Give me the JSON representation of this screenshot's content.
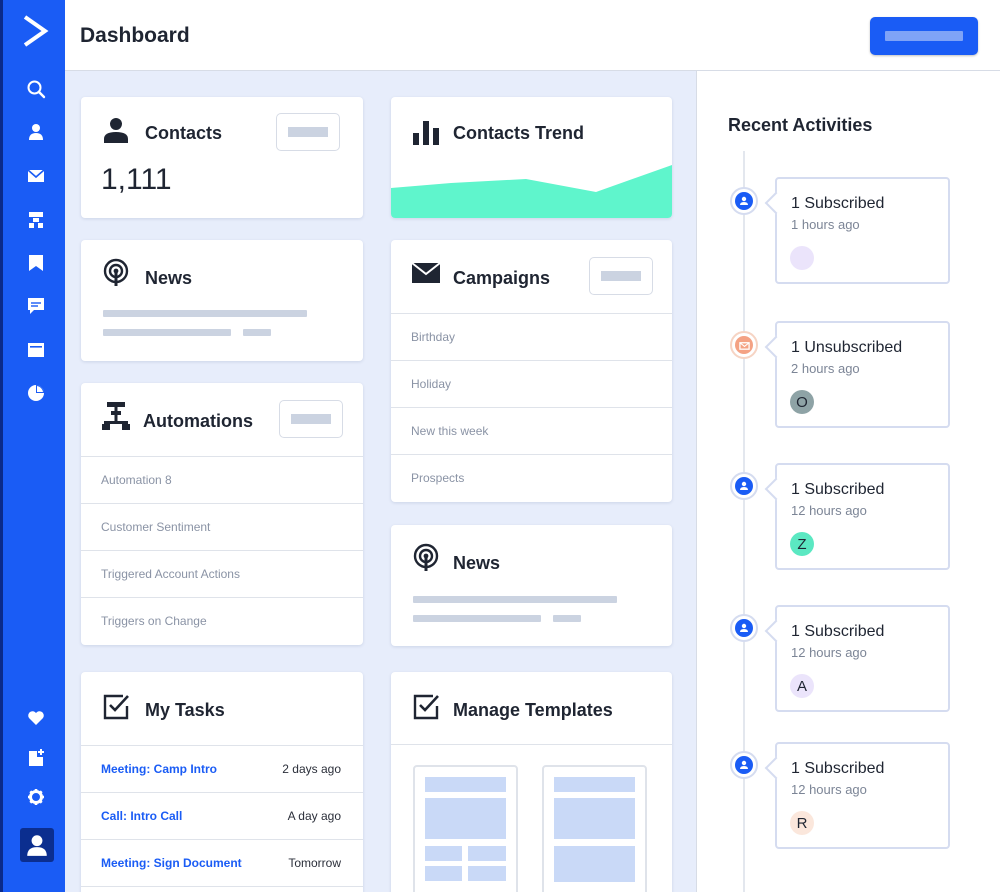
{
  "header": {
    "title": "Dashboard"
  },
  "sidebar": {
    "icons": [
      "logo-icon",
      "search-icon",
      "person-icon",
      "mail-icon",
      "automation-icon",
      "bookmark-icon",
      "chat-icon",
      "window-icon",
      "pie-chart-icon",
      "heart-icon",
      "add-page-icon",
      "gear-icon",
      "user-avatar-icon"
    ]
  },
  "cards": {
    "contacts": {
      "title": "Contacts",
      "value": "1,111"
    },
    "contacts_trend": {
      "title": "Contacts Trend"
    },
    "news_left": {
      "title": "News"
    },
    "campaigns": {
      "title": "Campaigns",
      "items": [
        "Birthday",
        "Holiday",
        "New this week",
        "Prospects"
      ]
    },
    "automations": {
      "title": "Automations",
      "items": [
        "Automation 8",
        "Customer Sentiment",
        "Triggered Account Actions",
        "Triggers on Change"
      ]
    },
    "news_right": {
      "title": "News"
    },
    "tasks": {
      "title": "My Tasks",
      "items": [
        {
          "name": "Meeting: Camp Intro",
          "time": "2 days ago"
        },
        {
          "name": "Call: Intro Call",
          "time": "A day ago"
        },
        {
          "name": "Meeting: Sign Document",
          "time": "Tomorrow"
        }
      ]
    },
    "templates": {
      "title": "Manage Templates"
    }
  },
  "recent": {
    "title": "Recent Activities",
    "items": [
      {
        "title": "1 Subscribed",
        "time": "1 hours ago",
        "avatar": "",
        "icon": "subscribe-icon",
        "avatar_color": "#ebe4fb"
      },
      {
        "title": "1 Unsubscribed",
        "time": "2 hours ago",
        "avatar": "O",
        "icon": "mail-unsubscribe-icon",
        "avatar_color": "#8ea3a6"
      },
      {
        "title": "1 Subscribed",
        "time": "12 hours ago",
        "avatar": "Z",
        "icon": "subscribe-icon",
        "avatar_color": "#5be8c2"
      },
      {
        "title": "1 Subscribed",
        "time": "12 hours ago",
        "avatar": "A",
        "icon": "subscribe-icon",
        "avatar_color": "#ebe4fb"
      },
      {
        "title": "1 Subscribed",
        "time": "12 hours ago",
        "avatar": "R",
        "icon": "subscribe-icon",
        "avatar_color": "#fbe7dc"
      }
    ]
  },
  "colors": {
    "brand": "#1a5cf5",
    "trend_fill": "#5ff5cc",
    "background": "#e7edfb"
  }
}
